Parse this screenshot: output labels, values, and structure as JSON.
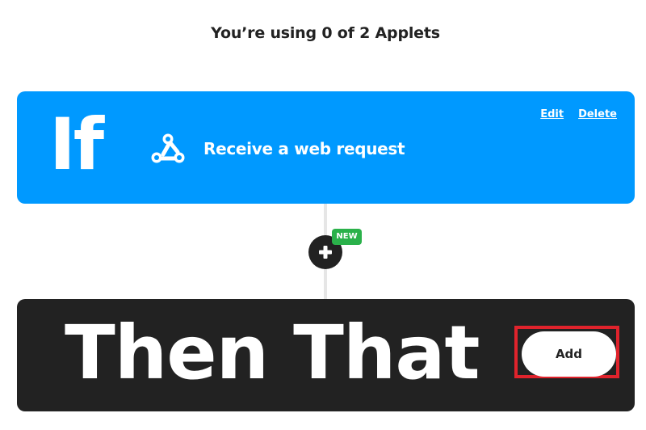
{
  "header": {
    "usage_text": "You’re using 0 of 2 Applets"
  },
  "if_card": {
    "keyword": "If",
    "trigger_icon": "webhook-icon",
    "trigger_label": "Receive a web request",
    "edit_label": "Edit",
    "delete_label": "Delete",
    "color": "#0099ff"
  },
  "connector": {
    "add_step_icon": "plus-icon",
    "badge_label": "NEW",
    "badge_color": "#2ab14a"
  },
  "then_card": {
    "keyword": "Then That",
    "add_label": "Add",
    "color": "#222222",
    "highlight_color": "#e0232c"
  }
}
